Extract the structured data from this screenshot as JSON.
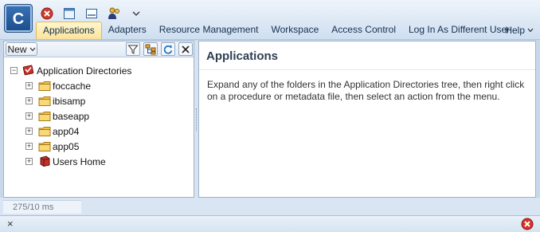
{
  "toolbar": {
    "logo_letter": "C",
    "icons": [
      "close-circle-icon",
      "window-icon",
      "console-icon",
      "users-icon",
      "chevron-down-icon"
    ]
  },
  "menu": {
    "items": [
      {
        "label": "Applications",
        "active": true
      },
      {
        "label": "Adapters"
      },
      {
        "label": "Resource Management"
      },
      {
        "label": "Workspace"
      },
      {
        "label": "Access Control"
      },
      {
        "label": "Log In As Different User"
      }
    ],
    "help_label": "Help"
  },
  "left_toolbar": {
    "new_label": "New",
    "tools": [
      "filter-icon",
      "hierarchy-icon",
      "refresh-icon",
      "close-icon"
    ]
  },
  "tree": {
    "root": {
      "label": "Application Directories",
      "icon": "app-directories-icon"
    },
    "children": [
      {
        "label": "foccache",
        "icon": "folder-icon"
      },
      {
        "label": "ibisamp",
        "icon": "folder-icon"
      },
      {
        "label": "baseapp",
        "icon": "folder-icon"
      },
      {
        "label": "app04",
        "icon": "folder-icon"
      },
      {
        "label": "app05",
        "icon": "folder-icon"
      },
      {
        "label": "Users Home",
        "icon": "users-home-icon"
      }
    ]
  },
  "main": {
    "title": "Applications",
    "description": "Expand any of the folders in the Application Directories tree, then right click on a procedure or metadata file, then select an action from the menu."
  },
  "status": {
    "timing": "275/10 ms"
  },
  "bottom": {
    "close_glyph": "×"
  },
  "colors": {
    "active_tab": "#fbe39a",
    "accent": "#1b4d8c",
    "error": "#d93025"
  }
}
